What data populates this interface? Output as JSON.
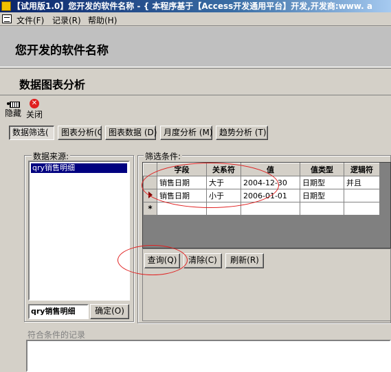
{
  "window": {
    "title": "【试用版1.0】您开发的软件名称 - { 本程序基于【Access开发通用平台】开发,开发商:www. a"
  },
  "menu": {
    "file": "文件(F)",
    "record": "记录(R)",
    "help": "帮助(H)"
  },
  "header": {
    "app_title": "您开发的软件名称",
    "page_title": "数据图表分析"
  },
  "toolbar": {
    "hide_label": "隐藏",
    "close_label": "关闭",
    "close_glyph": "✕"
  },
  "tabs": [
    {
      "label": "数据筛选("
    },
    {
      "label": "图表分析(G"
    },
    {
      "label": "图表数据 (D)"
    },
    {
      "label": "月度分析 (M)"
    },
    {
      "label": "趋势分析 (T)"
    }
  ],
  "source": {
    "group_label": "数据来源:",
    "list_items": [
      "qry销售明细"
    ],
    "selected_value": "qry销售明细",
    "confirm_button": "确定(O)"
  },
  "filter": {
    "group_label": "筛选条件:",
    "columns": [
      "字段",
      "关系符",
      "值",
      "值类型",
      "逻辑符"
    ],
    "rows": [
      {
        "field": "销售日期",
        "op": "大于",
        "value": "2004-12-30",
        "type": "日期型",
        "logic": "并且"
      },
      {
        "field": "销售日期",
        "op": "小于",
        "value": "2006-01-01",
        "type": "日期型",
        "logic": ""
      }
    ],
    "new_row_marker": "*",
    "query_button": "查询(Q)",
    "clear_button": "清除(C)",
    "refresh_button": "刷新(R)"
  },
  "results": {
    "label": "符合条件的记录"
  },
  "colors": {
    "titlebar": "#0a246a",
    "face": "#d4d0c8",
    "annotation": "#e02020",
    "selection": "#000080"
  }
}
